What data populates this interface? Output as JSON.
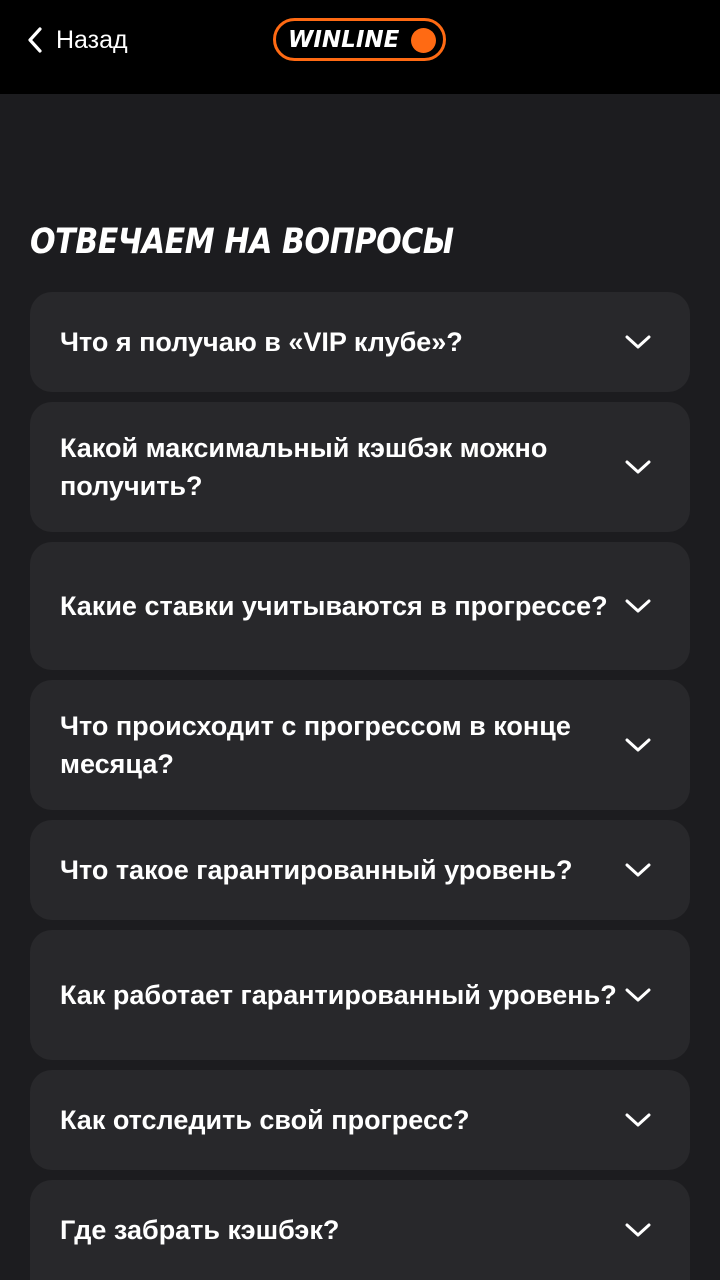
{
  "header": {
    "back_label": "Назад",
    "logo_text": "WINLINE",
    "brand_color": "#ff6a13",
    "back_icon": "chevron-left-icon"
  },
  "section": {
    "title": "ОТВЕЧАЕМ НА ВОПРОСЫ"
  },
  "faq": {
    "items": [
      {
        "question": "Что я получаю в «VIP клубе»?"
      },
      {
        "question": "Какой максимальный кэшбэк можно получить?"
      },
      {
        "question": "Какие ставки учитываются в прогрессе?"
      },
      {
        "question": "Что происходит с прогрессом в конце месяца?"
      },
      {
        "question": "Что такое гарантированный уровень?"
      },
      {
        "question": "Как работает гарантированный уровень?"
      },
      {
        "question": "Как отследить свой прогресс?"
      },
      {
        "question": "Где забрать кэшбэк?"
      }
    ],
    "expand_icon": "chevron-down-icon"
  }
}
